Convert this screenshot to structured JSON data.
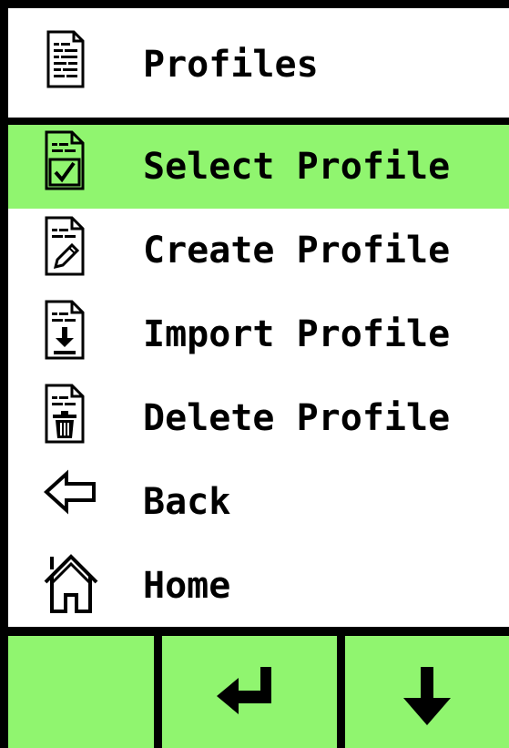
{
  "header": {
    "title": "Profiles",
    "icon": "document-list-icon"
  },
  "menu": {
    "items": [
      {
        "label": "Select Profile",
        "icon": "document-check-icon",
        "selected": true
      },
      {
        "label": "Create Profile",
        "icon": "document-edit-icon",
        "selected": false
      },
      {
        "label": "Import Profile",
        "icon": "document-import-icon",
        "selected": false
      },
      {
        "label": "Delete Profile",
        "icon": "document-delete-icon",
        "selected": false
      },
      {
        "label": "Back",
        "icon": "arrow-left-icon",
        "selected": false
      },
      {
        "label": "Home",
        "icon": "home-icon",
        "selected": false
      }
    ]
  },
  "softkeys": [
    {
      "icon": ""
    },
    {
      "icon": "enter-icon"
    },
    {
      "icon": "arrow-down-icon"
    }
  ],
  "colors": {
    "highlight": "#90f56f",
    "background": "#ffffff",
    "frame": "#000000"
  }
}
